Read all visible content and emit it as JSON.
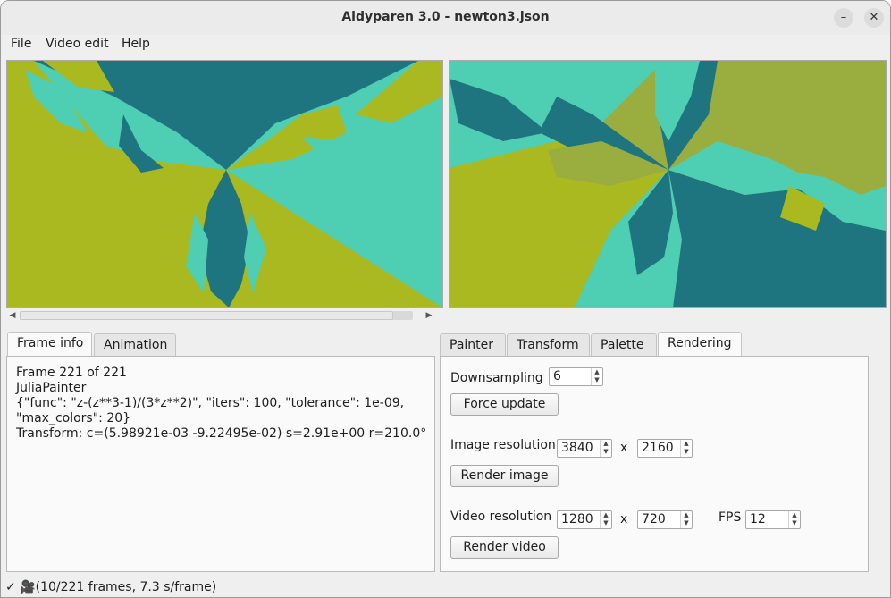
{
  "window": {
    "title": "Aldyparen 3.0 - newton3.json",
    "minimize_glyph": "–",
    "close_glyph": "✕"
  },
  "menu": {
    "file": "File",
    "video_edit": "Video edit",
    "help": "Help"
  },
  "colors": {
    "teal_dark": "#1e7580",
    "teal_light": "#4ecfb3",
    "olive": "#a9b91f",
    "olive_right": "#9aad3f"
  },
  "left_tabs": {
    "frame_info": "Frame info",
    "animation": "Animation"
  },
  "frame_info": {
    "line1": "Frame 221 of 221",
    "line2": "JuliaPainter",
    "line3": "{\"func\": \"z-(z**3-1)/(3*z**2)\", \"iters\": 100, \"tolerance\": 1e-09,",
    "line4": "\"max_colors\": 20}",
    "line5": "Transform: c=(5.98921e-03 -9.22495e-02) s=2.91e+00 r=210.0°"
  },
  "right_tabs": {
    "painter": "Painter",
    "transform": "Transform",
    "palette": "Palette",
    "rendering": "Rendering"
  },
  "rendering": {
    "downsampling_label": "Downsampling",
    "downsampling_value": "6",
    "force_update": "Force update",
    "image_resolution_label": "Image resolution",
    "image_width": "3840",
    "image_height": "2160",
    "x_sep": "x",
    "render_image": "Render image",
    "video_resolution_label": "Video resolution",
    "video_width": "1280",
    "video_height": "720",
    "fps_label": "FPS",
    "fps_value": "12",
    "render_video": "Render video"
  },
  "status": {
    "text": "✓ 🎥(10/221 frames, 7.3 s/frame)"
  }
}
